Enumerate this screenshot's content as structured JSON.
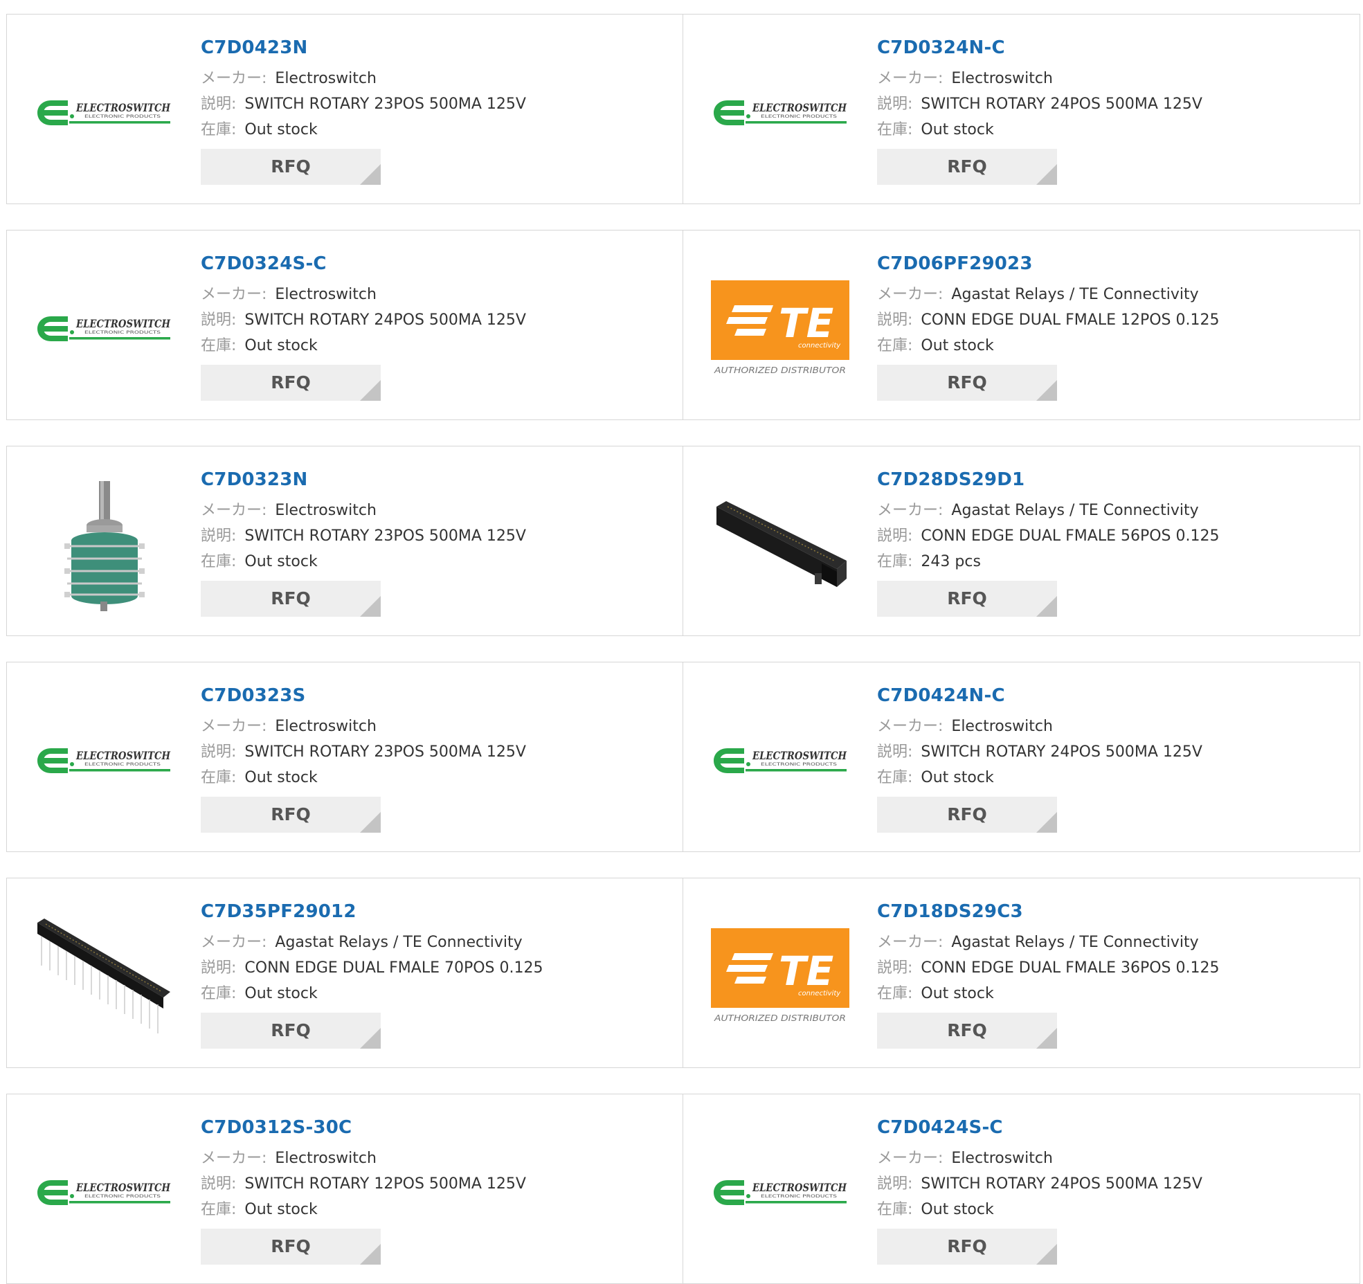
{
  "labels": {
    "maker": "メーカー:",
    "desc": "説明:",
    "stock": "在庫:",
    "rfq": "RFQ"
  },
  "logos": {
    "electroswitch_name": "ELECTROSWITCH",
    "electroswitch_sub": "ELECTRONIC PRODUCTS",
    "te_mark": "TE",
    "te_sub": "connectivity",
    "te_distributor": "AUTHORIZED DISTRIBUTOR"
  },
  "colors": {
    "link": "#1a6bb0",
    "electroswitch_green": "#2aa84a",
    "te_orange": "#f7941d",
    "button_bg": "#eeeeee"
  },
  "products": [
    {
      "part": "C7D0423N",
      "maker": "Electroswitch",
      "desc": "SWITCH ROTARY 23POS 500MA 125V",
      "stock": "Out stock",
      "image": "electroswitch-logo"
    },
    {
      "part": "C7D0324N-C",
      "maker": "Electroswitch",
      "desc": "SWITCH ROTARY 24POS 500MA 125V",
      "stock": "Out stock",
      "image": "electroswitch-logo"
    },
    {
      "part": "C7D0324S-C",
      "maker": "Electroswitch",
      "desc": "SWITCH ROTARY 24POS 500MA 125V",
      "stock": "Out stock",
      "image": "electroswitch-logo"
    },
    {
      "part": "C7D06PF29023",
      "maker": "Agastat Relays / TE Connectivity",
      "desc": "CONN EDGE DUAL FMALE 12POS 0.125",
      "stock": "Out stock",
      "image": "te-logo"
    },
    {
      "part": "C7D0323N",
      "maker": "Electroswitch",
      "desc": "SWITCH ROTARY 23POS 500MA 125V",
      "stock": "Out stock",
      "image": "rotary-switch-photo"
    },
    {
      "part": "C7D28DS29D1",
      "maker": "Agastat Relays / TE Connectivity",
      "desc": "CONN EDGE DUAL FMALE 56POS 0.125",
      "stock": "243 pcs",
      "image": "edge-connector-photo"
    },
    {
      "part": "C7D0323S",
      "maker": "Electroswitch",
      "desc": "SWITCH ROTARY 23POS 500MA 125V",
      "stock": "Out stock",
      "image": "electroswitch-logo"
    },
    {
      "part": "C7D0424N-C",
      "maker": "Electroswitch",
      "desc": "SWITCH ROTARY 24POS 500MA 125V",
      "stock": "Out stock",
      "image": "electroswitch-logo"
    },
    {
      "part": "C7D35PF29012",
      "maker": "Agastat Relays / TE Connectivity",
      "desc": "CONN EDGE DUAL FMALE 70POS 0.125",
      "stock": "Out stock",
      "image": "long-connector-photo"
    },
    {
      "part": "C7D18DS29C3",
      "maker": "Agastat Relays / TE Connectivity",
      "desc": "CONN EDGE DUAL FMALE 36POS 0.125",
      "stock": "Out stock",
      "image": "te-logo"
    },
    {
      "part": "C7D0312S-30C",
      "maker": "Electroswitch",
      "desc": "SWITCH ROTARY 12POS 500MA 125V",
      "stock": "Out stock",
      "image": "electroswitch-logo"
    },
    {
      "part": "C7D0424S-C",
      "maker": "Electroswitch",
      "desc": "SWITCH ROTARY 24POS 500MA 125V",
      "stock": "Out stock",
      "image": "electroswitch-logo"
    }
  ]
}
